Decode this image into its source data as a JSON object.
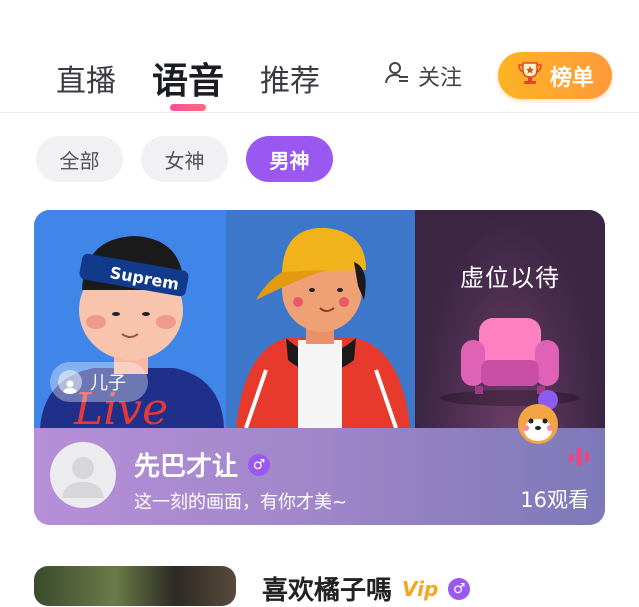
{
  "tabs": [
    {
      "label": "直播",
      "active": false
    },
    {
      "label": "语音",
      "active": true
    },
    {
      "label": "推荐",
      "active": false
    }
  ],
  "header": {
    "follow_label": "关注",
    "rank_label": "榜单",
    "icons": {
      "follow": "user-add-icon",
      "rank": "trophy-icon"
    }
  },
  "filters": [
    {
      "label": "全部",
      "active": false
    },
    {
      "label": "女神",
      "active": false
    },
    {
      "label": "男神",
      "active": true
    }
  ],
  "room": {
    "seat_name": "儿子",
    "empty_seat_text": "虚位以待",
    "title": "先巴才让",
    "gender_symbol": "♂",
    "description": "这一刻的画面，有你才美~",
    "viewers": "16观看",
    "shirt_text": "Live",
    "cap_text": "Suprem"
  },
  "room2": {
    "title": "喜欢橘子嗎",
    "vip_text": "Vip",
    "gender_symbol": "♂"
  },
  "colors": {
    "accent_purple": "#9a58f1",
    "accent_pink": "#ff4f9a",
    "rank_orange": "#ffb323"
  }
}
